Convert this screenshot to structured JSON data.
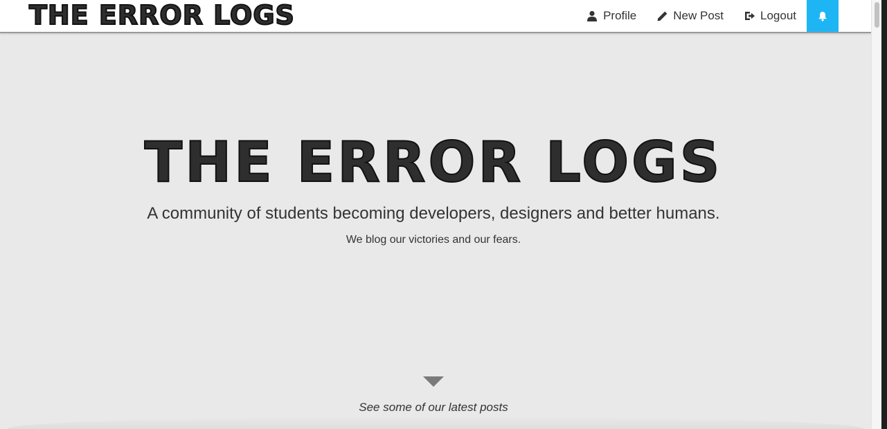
{
  "navbar": {
    "brand": "THE ERROR LOGS",
    "links": [
      {
        "label": "Profile",
        "icon": "user-icon"
      },
      {
        "label": "New Post",
        "icon": "pencil-icon"
      },
      {
        "label": "Logout",
        "icon": "logout-icon"
      }
    ],
    "notification_icon": "bell-icon"
  },
  "hero": {
    "title": "THE ERROR LOGS",
    "tagline": "A community of students becoming developers, designers and better humans.",
    "subtitle": "We blog our victories and our fears.",
    "scroll_label": "See some of our latest posts"
  },
  "colors": {
    "accent": "#1eb5f5",
    "background": "#e9e9e9",
    "text": "#333333",
    "title_fill": "#2e2e2e"
  }
}
